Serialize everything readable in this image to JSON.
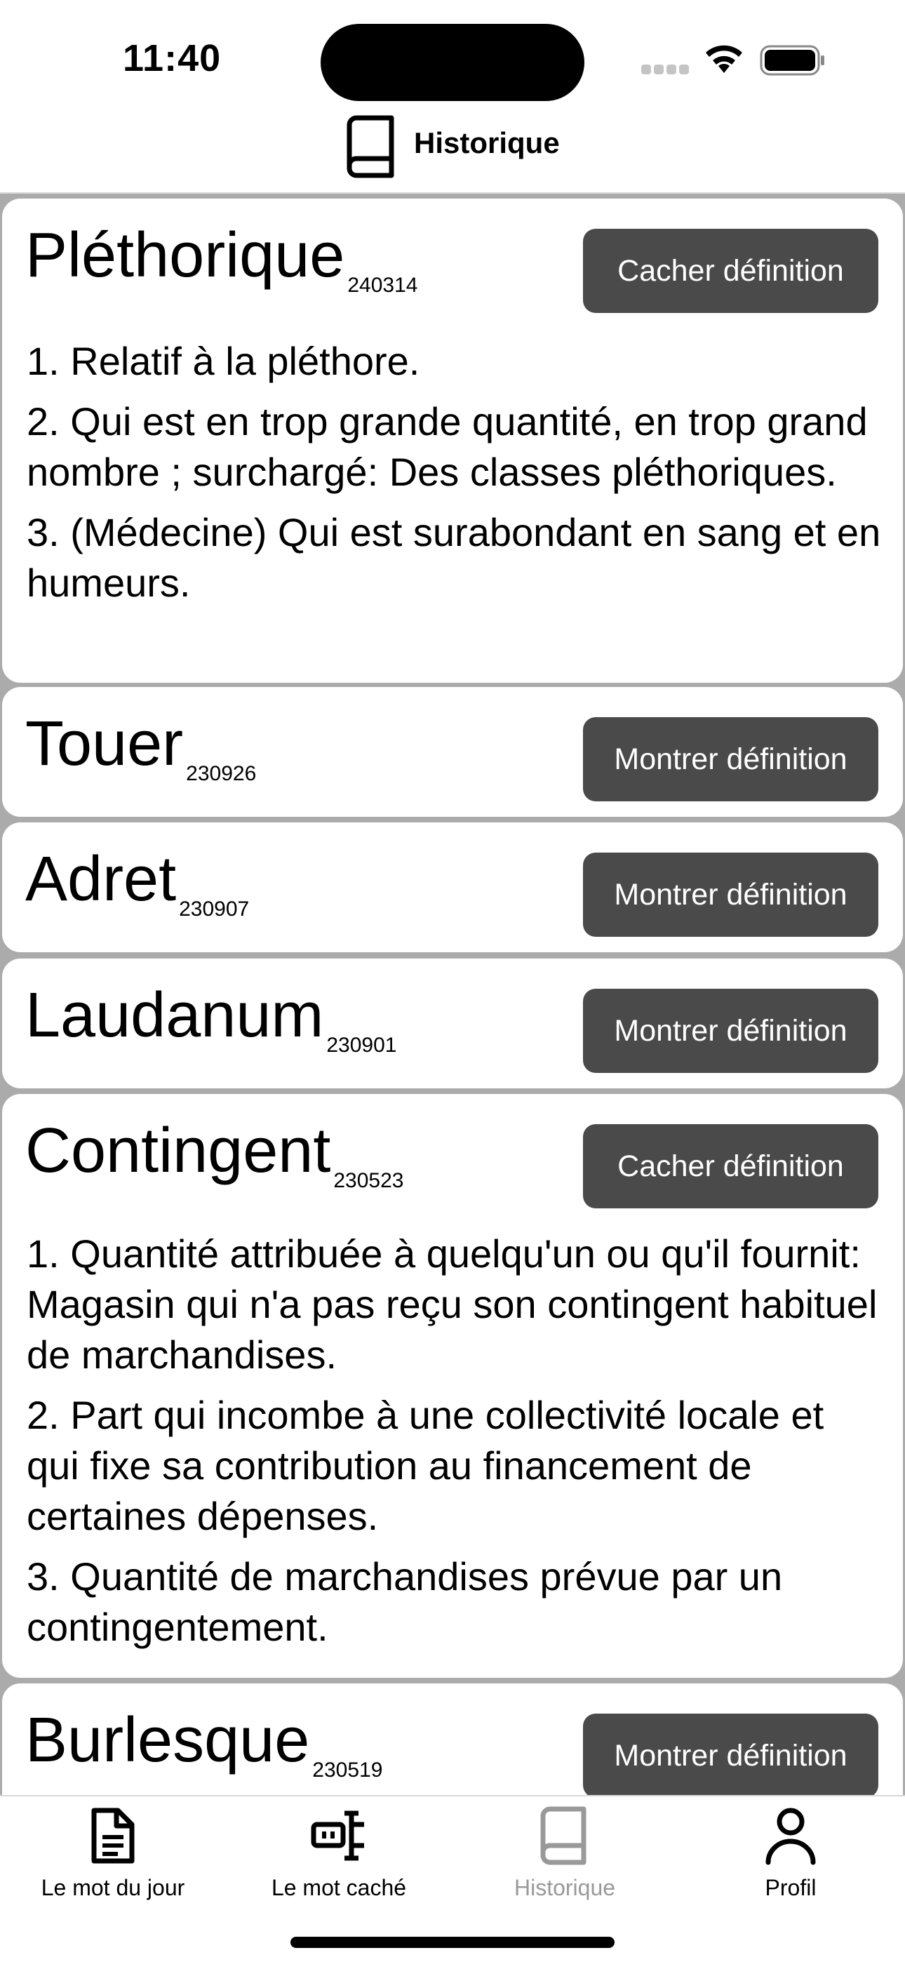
{
  "status": {
    "time": "11:40"
  },
  "header": {
    "title": "Historique",
    "icon": "book-icon"
  },
  "entries": [
    {
      "word": "Pléthorique",
      "date": "240314",
      "button": "Cacher définition",
      "definitions": [
        "1. Relatif à la pléthore.",
        "2. Qui est en trop grande quantité, en trop grand nombre ; surchargé: Des classes pléthoriques.",
        "3. (Médecine) Qui est surabondant en sang et en humeurs."
      ]
    },
    {
      "word": "Touer",
      "date": "230926",
      "button": "Montrer définition",
      "definitions": []
    },
    {
      "word": "Adret",
      "date": "230907",
      "button": "Montrer définition",
      "definitions": []
    },
    {
      "word": "Laudanum",
      "date": "230901",
      "button": "Montrer définition",
      "definitions": []
    },
    {
      "word": "Contingent",
      "date": "230523",
      "button": "Cacher définition",
      "definitions": [
        "1. Quantité attribuée à quelqu'un ou qu'il fournit: Magasin qui n'a pas reçu son contingent habituel de marchandises.",
        "2. Part qui incombe à une collectivité locale et qui fixe sa contribution au financement de certaines dépenses.",
        "3. Quantité de marchandises prévue par un contingentement."
      ]
    },
    {
      "word": "Burlesque",
      "date": "230519",
      "button": "Montrer définition",
      "definitions": []
    }
  ],
  "tabs": [
    {
      "label": "Le mot du jour",
      "icon": "document-icon"
    },
    {
      "label": "Le mot caché",
      "icon": "hidden-word-icon"
    },
    {
      "label": "Historique",
      "icon": "book-icon",
      "active": true
    },
    {
      "label": "Profil",
      "icon": "person-icon"
    }
  ],
  "colors": {
    "button_bg": "#4a4a4a",
    "list_bg": "#ababab",
    "active_tab": "#999999"
  }
}
